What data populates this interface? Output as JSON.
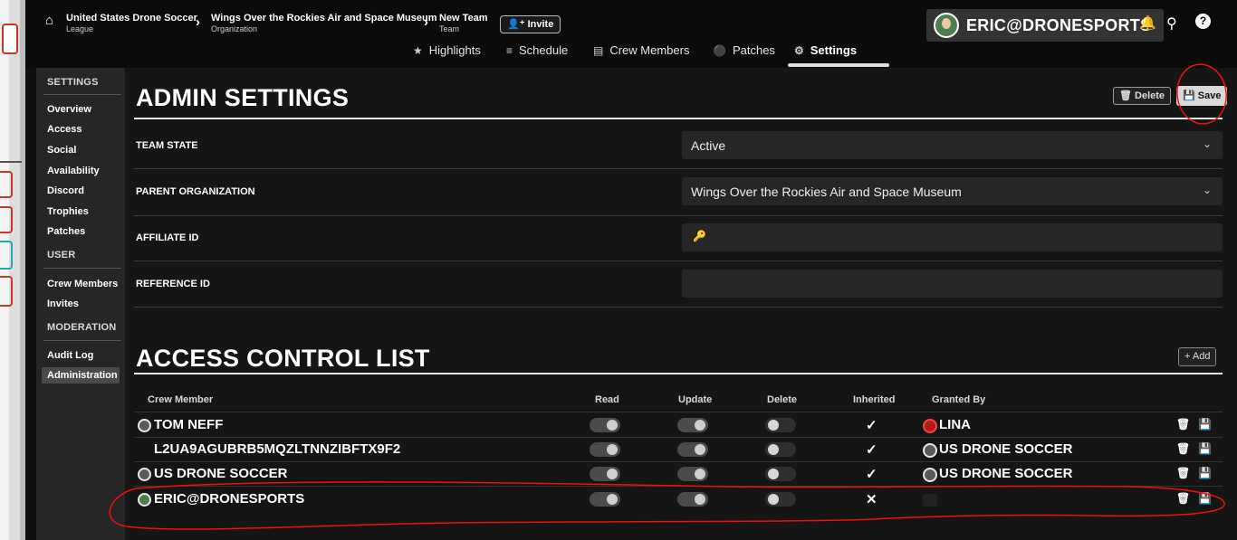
{
  "breadcrumbs": [
    {
      "title": "United States Drone Soccer",
      "sub": "League"
    },
    {
      "title": "Wings Over the Rockies Air and Space Museum",
      "sub": "Organization"
    },
    {
      "title": "New Team",
      "sub": "Team"
    }
  ],
  "invite_label": "Invite",
  "user": {
    "name": "ERIC@DRONESPORTS"
  },
  "tabs": [
    {
      "label": "Highlights",
      "icon": "star-icon"
    },
    {
      "label": "Schedule",
      "icon": "list-icon"
    },
    {
      "label": "Crew Members",
      "icon": "id-card-icon"
    },
    {
      "label": "Patches",
      "icon": "shield-icon"
    },
    {
      "label": "Settings",
      "icon": "gear-icon",
      "active": true
    }
  ],
  "sidebar": {
    "settings_heading": "SETTINGS",
    "settings_items": [
      "Overview",
      "Access",
      "Social",
      "Availability",
      "Discord",
      "Trophies",
      "Patches"
    ],
    "user_heading": "USER",
    "user_items": [
      "Crew Members",
      "Invites"
    ],
    "moderation_heading": "MODERATION",
    "moderation_items": [
      "Audit Log",
      "Administration"
    ]
  },
  "admin": {
    "title": "ADMIN SETTINGS",
    "delete_label": "Delete",
    "save_label": "Save",
    "team_state_label": "TEAM STATE",
    "team_state_value": "Active",
    "parent_org_label": "PARENT ORGANIZATION",
    "parent_org_value": "Wings Over the Rockies Air and Space Museum",
    "affiliate_label": "AFFILIATE ID",
    "affiliate_value": "",
    "reference_label": "REFERENCE ID",
    "reference_value": ""
  },
  "acl": {
    "title": "ACCESS CONTROL LIST",
    "add_label": "Add",
    "headers": {
      "crew": "Crew Member",
      "read": "Read",
      "update": "Update",
      "delete": "Delete",
      "inherited": "Inherited",
      "granted": "Granted By"
    },
    "rows": [
      {
        "name": "TOM NEFF",
        "read": true,
        "update": true,
        "delete": false,
        "inherited": "✓",
        "granted_by": "LINA"
      },
      {
        "name": "L2UA9AGUBRB5MQZLTNNZIBFTX9F2",
        "read": true,
        "update": true,
        "delete": false,
        "inherited": "✓",
        "granted_by": "US DRONE SOCCER"
      },
      {
        "name": "US DRONE SOCCER",
        "read": true,
        "update": true,
        "delete": false,
        "inherited": "✓",
        "granted_by": "US DRONE SOCCER"
      },
      {
        "name": "ERIC@DRONESPORTS",
        "read": true,
        "update": true,
        "delete": false,
        "inherited": "✕",
        "granted_by": ""
      }
    ]
  },
  "colors": {
    "background": "#151515",
    "sidebar": "#262626",
    "annotation": "#e11111"
  }
}
